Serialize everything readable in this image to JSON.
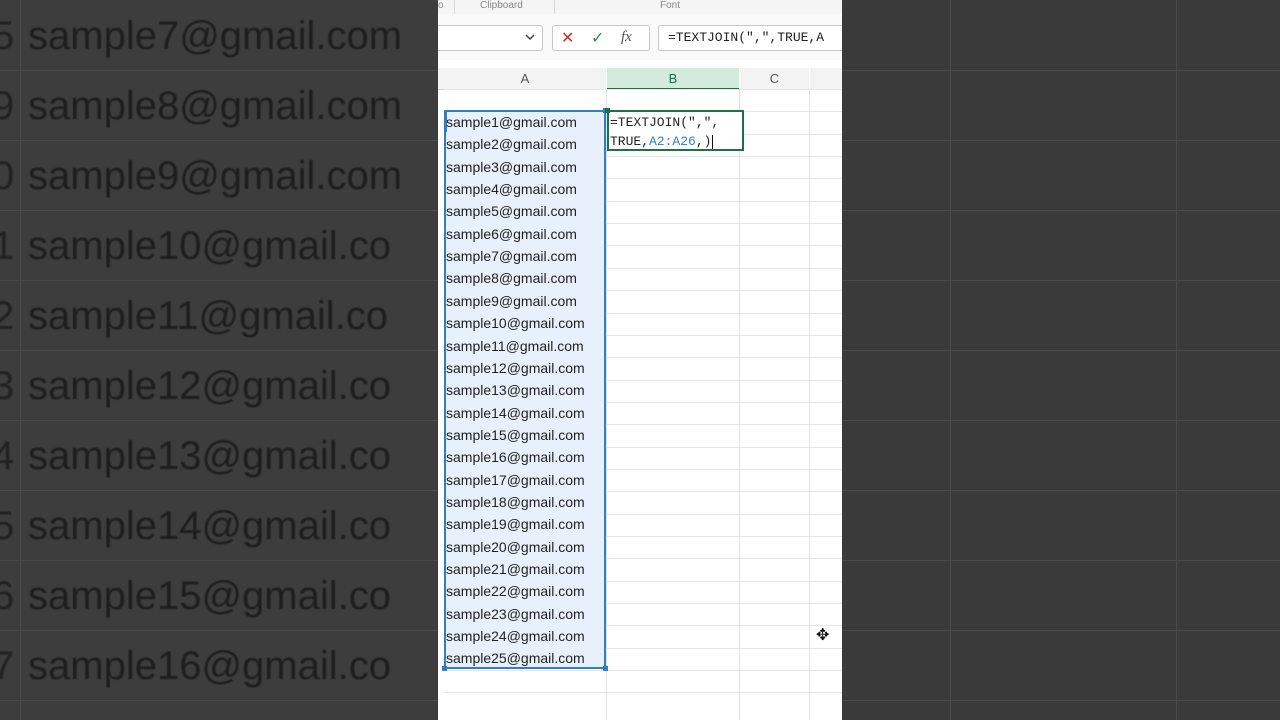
{
  "ribbon": {
    "group_clipboard": "Clipboard",
    "group_font": "Font",
    "group_partial": "o"
  },
  "formula_bar": {
    "name_box": "",
    "cancel_glyph": "✕",
    "enter_glyph": "✓",
    "fx_glyph": "fx",
    "content": "=TEXTJOIN(\",\",TRUE,A"
  },
  "columns": {
    "a": "A",
    "b": "B",
    "c": "C"
  },
  "cells_a": [
    "sample1@gmail.com",
    "sample2@gmail.com",
    "sample3@gmail.com",
    "sample4@gmail.com",
    "sample5@gmail.com",
    "sample6@gmail.com",
    "sample7@gmail.com",
    "sample8@gmail.com",
    "sample9@gmail.com",
    "sample10@gmail.com",
    "sample11@gmail.com",
    "sample12@gmail.com",
    "sample13@gmail.com",
    "sample14@gmail.com",
    "sample15@gmail.com",
    "sample16@gmail.com",
    "sample17@gmail.com",
    "sample18@gmail.com",
    "sample19@gmail.com",
    "sample20@gmail.com",
    "sample21@gmail.com",
    "sample22@gmail.com",
    "sample23@gmail.com",
    "sample24@gmail.com",
    "sample25@gmail.com"
  ],
  "edit_cell": {
    "line1": "=TEXTJOIN(\",\",",
    "line2_prefix": "TRUE,",
    "line2_ref": "A2:A26",
    "line2_suffix": ",)"
  },
  "background_rows": [
    {
      "num": "5",
      "text": "sample7@gmail.com"
    },
    {
      "num": "9",
      "text": "sample8@gmail.com"
    },
    {
      "num": "0",
      "text": "sample9@gmail.com"
    },
    {
      "num": "1",
      "text": "sample10@gmail.co"
    },
    {
      "num": "2",
      "text": "sample11@gmail.co"
    },
    {
      "num": "3",
      "text": "sample12@gmail.co"
    },
    {
      "num": "4",
      "text": "sample13@gmail.co"
    },
    {
      "num": "5",
      "text": "sample14@gmail.co"
    },
    {
      "num": "6",
      "text": "sample15@gmail.co"
    },
    {
      "num": "7",
      "text": "sample16@gmail.co"
    }
  ],
  "cursor_glyph": "✥"
}
